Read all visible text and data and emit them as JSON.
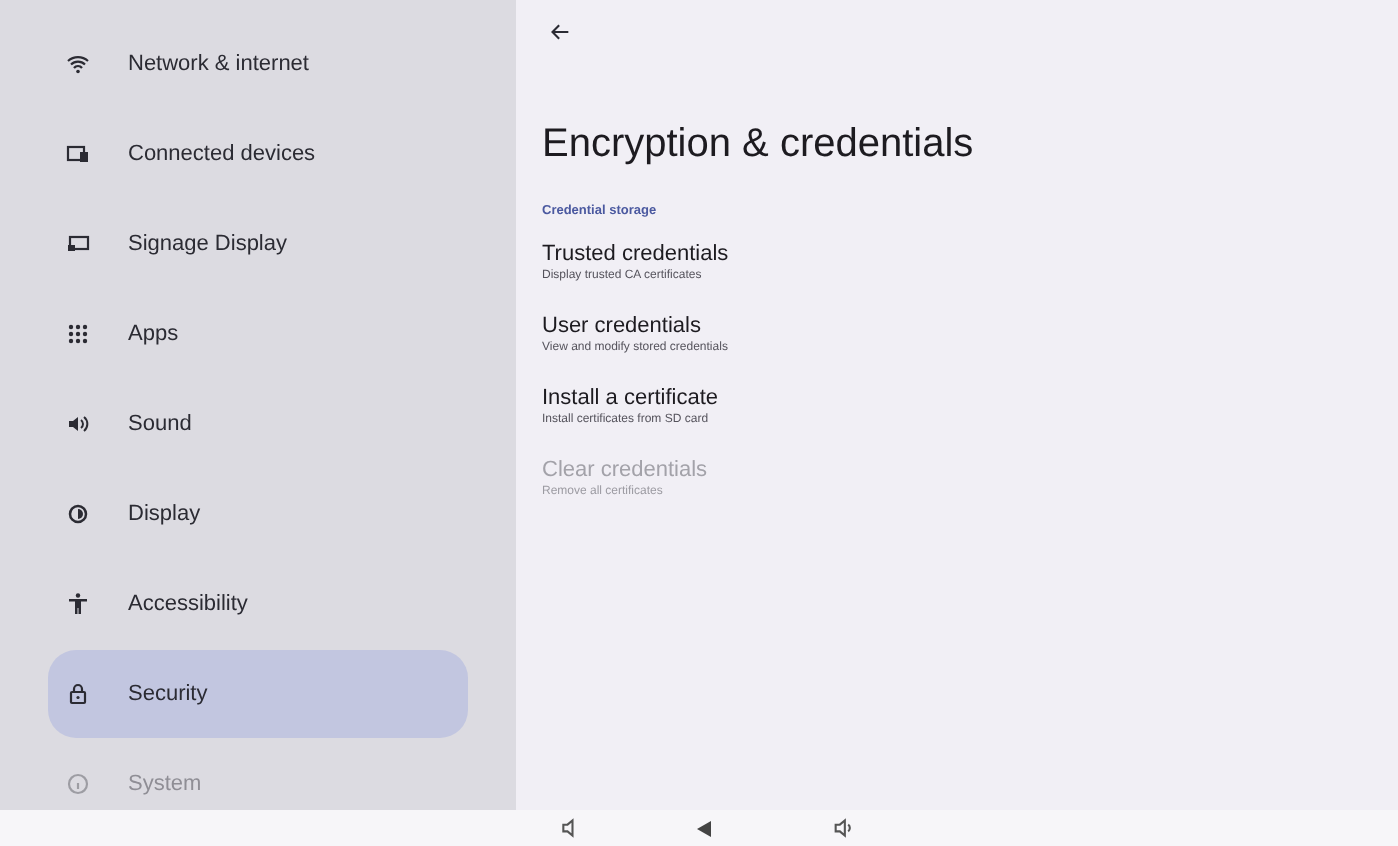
{
  "sidebar": {
    "items": [
      {
        "kind": "wifi",
        "label": "Network & internet",
        "selected": false
      },
      {
        "kind": "devices",
        "label": "Connected devices",
        "selected": false
      },
      {
        "kind": "signage",
        "label": "Signage Display",
        "selected": false
      },
      {
        "kind": "apps",
        "label": "Apps",
        "selected": false
      },
      {
        "kind": "sound",
        "label": "Sound",
        "selected": false
      },
      {
        "kind": "display",
        "label": "Display",
        "selected": false
      },
      {
        "kind": "accessibility",
        "label": "Accessibility",
        "selected": false
      },
      {
        "kind": "security",
        "label": "Security",
        "selected": true
      },
      {
        "kind": "system",
        "label": "System",
        "selected": false
      }
    ]
  },
  "page": {
    "title": "Encryption & credentials",
    "section": "Credential storage",
    "items": [
      {
        "title": "Trusted credentials",
        "subtitle": "Display trusted CA certificates",
        "disabled": false
      },
      {
        "title": "User credentials",
        "subtitle": "View and modify stored credentials",
        "disabled": false
      },
      {
        "title": "Install a certificate",
        "subtitle": "Install certificates from SD card",
        "disabled": false
      },
      {
        "title": "Clear credentials",
        "subtitle": "Remove all certificates",
        "disabled": true
      }
    ]
  }
}
